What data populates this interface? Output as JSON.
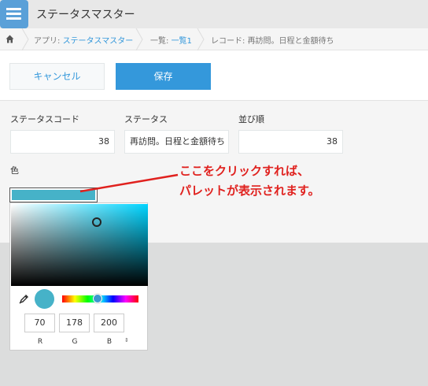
{
  "app": {
    "title": "ステータスマスター",
    "icon": "list-icon"
  },
  "breadcrumb": {
    "icon": "home-icon",
    "items": [
      {
        "prefix": "アプリ: ",
        "link": "ステータスマスター"
      },
      {
        "prefix": "一覧: ",
        "link": "一覧1"
      },
      {
        "prefix": "レコード: ",
        "text": "再訪問。日程と金額待ち"
      }
    ]
  },
  "toolbar": {
    "cancel_label": "キャンセル",
    "save_label": "保存"
  },
  "form": {
    "fields": [
      {
        "label": "ステータスコード",
        "value": "38"
      },
      {
        "label": "ステータス",
        "value": "再訪問。日程と金額待ち"
      },
      {
        "label": "並び順",
        "value": "38"
      }
    ],
    "color_label": "色",
    "color_value": "#46b2c8"
  },
  "annotation": {
    "lines": [
      "ここをクリックすれば、",
      "パレットが表示されます。"
    ],
    "color": "#e0211e"
  },
  "picker": {
    "hue_color": "#00d4ff",
    "r": "70",
    "g": "178",
    "b": "200",
    "r_label": "R",
    "g_label": "G",
    "b_label": "B",
    "mode_toggle": "⇕",
    "dropper_icon": "eyedropper-icon"
  },
  "colors": {
    "accent": "#3498db",
    "header_bg": "#e8e8e8"
  }
}
